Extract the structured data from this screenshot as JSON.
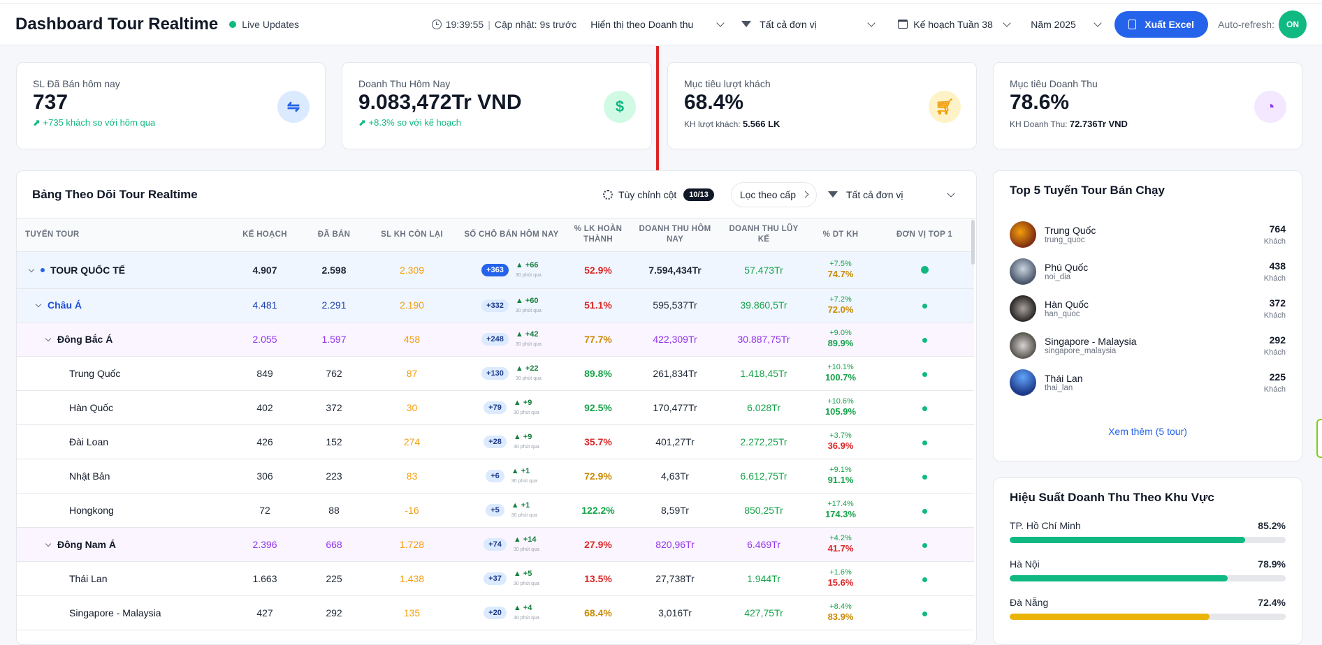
{
  "header": {
    "title": "Dashboard Tour Realtime",
    "live_label": "Live Updates",
    "time": "19:39:55",
    "updated": "Cập nhật: 9s trước",
    "display_select": "Hiển thị theo Doanh thu",
    "unit_select": "Tất cả đơn vị",
    "plan_select": "Kế hoạch Tuần 38",
    "year_select": "Năm 2025",
    "export_label": "Xuất Excel",
    "autorefresh_label": "Auto-refresh:",
    "autorefresh_state": "ON"
  },
  "kpis": [
    {
      "label": "SL Đã Bán hôm nay",
      "value": "737",
      "sub": "+735 khách so với hôm qua",
      "icon": "sliders-icon"
    },
    {
      "label": "Doanh Thu Hôm Nay",
      "value": "9.083,472Tr VND",
      "sub": "+8.3% so với kế hoạch",
      "icon": "dollar-icon"
    },
    {
      "label": "Mục tiêu lượt khách",
      "value": "68.4%",
      "sub_label": "KH lượt khách:",
      "sub_value": "5.566 LK",
      "icon": "cart-icon"
    },
    {
      "label": "Mục tiêu Doanh Thu",
      "value": "78.6%",
      "sub_label": "KH Doanh Thu:",
      "sub_value": "72.736Tr VND",
      "icon": "pie-chart-icon"
    }
  ],
  "table": {
    "title": "Bảng Theo Dõi Tour Realtime",
    "columns_btn": "Tùy chỉnh cột",
    "columns_count": "10/13",
    "filter_level": "Lọc theo cấp",
    "unit_filter": "Tất cả đơn vị",
    "headers": [
      "TUYẾN TOUR",
      "KẾ HOẠCH",
      "ĐÃ BÁN",
      "SL KH CÒN LẠI",
      "SỐ CHỖ BÁN HÔM NAY",
      "% LK HOÀN THÀNH",
      "DOANH THU HÔM NAY",
      "DOANH THU LŨY KẾ",
      "% DT KH",
      "ĐƠN VỊ TOP 1"
    ],
    "rows": [
      {
        "level": 0,
        "name": "TOUR QUỐC TẾ",
        "plan": "4.907",
        "sold": "2.598",
        "remain": "2.309",
        "today": "+363",
        "delta": "▲ +66",
        "ago": "30 phút qua",
        "pct": "52.9%",
        "rev_today": "7.594,434Tr",
        "rev_cum": "57.473Tr",
        "pdt_delta": "+7.5%",
        "pdt": "74.7%"
      },
      {
        "level": 1,
        "name": "Châu Á",
        "plan": "4.481",
        "sold": "2.291",
        "remain": "2.190",
        "today": "+332",
        "delta": "▲ +60",
        "ago": "30 phút qua",
        "pct": "51.1%",
        "rev_today": "595,537Tr",
        "rev_cum": "39.860,5Tr",
        "pdt_delta": "+7.2%",
        "pdt": "72.0%"
      },
      {
        "level": 2,
        "name": "Đông Bắc Á",
        "plan": "2.055",
        "sold": "1.597",
        "remain": "458",
        "today": "+248",
        "delta": "▲ +42",
        "ago": "30 phút qua",
        "pct": "77.7%",
        "rev_today": "422,309Tr",
        "rev_cum": "30.887,75Tr",
        "pdt_delta": "+9.0%",
        "pdt": "89.9%"
      },
      {
        "level": 3,
        "name": "Trung Quốc",
        "plan": "849",
        "sold": "762",
        "remain": "87",
        "today": "+130",
        "delta": "▲ +22",
        "ago": "30 phút qua",
        "pct": "89.8%",
        "rev_today": "261,834Tr",
        "rev_cum": "1.418,45Tr",
        "pdt_delta": "+10.1%",
        "pdt": "100.7%"
      },
      {
        "level": 3,
        "name": "Hàn Quốc",
        "plan": "402",
        "sold": "372",
        "remain": "30",
        "today": "+79",
        "delta": "▲ +9",
        "ago": "30 phút qua",
        "pct": "92.5%",
        "rev_today": "170,477Tr",
        "rev_cum": "6.028Tr",
        "pdt_delta": "+10.6%",
        "pdt": "105.9%"
      },
      {
        "level": 3,
        "name": "Đài Loan",
        "plan": "426",
        "sold": "152",
        "remain": "274",
        "today": "+28",
        "delta": "▲ +9",
        "ago": "30 phút qua",
        "pct": "35.7%",
        "rev_today": "401,27Tr",
        "rev_cum": "2.272,25Tr",
        "pdt_delta": "+3.7%",
        "pdt": "36.9%"
      },
      {
        "level": 3,
        "name": "Nhật Bản",
        "plan": "306",
        "sold": "223",
        "remain": "83",
        "today": "+6",
        "delta": "▲ +1",
        "ago": "30 phút qua",
        "pct": "72.9%",
        "rev_today": "4,63Tr",
        "rev_cum": "6.612,75Tr",
        "pdt_delta": "+9.1%",
        "pdt": "91.1%"
      },
      {
        "level": 3,
        "name": "Hongkong",
        "plan": "72",
        "sold": "88",
        "remain": "-16",
        "today": "+5",
        "delta": "▲ +1",
        "ago": "30 phút qua",
        "pct": "122.2%",
        "rev_today": "8,59Tr",
        "rev_cum": "850,25Tr",
        "pdt_delta": "+17.4%",
        "pdt": "174.3%"
      },
      {
        "level": 2,
        "name": "Đông Nam Á",
        "plan": "2.396",
        "sold": "668",
        "remain": "1.728",
        "today": "+74",
        "delta": "▲ +14",
        "ago": "30 phút qua",
        "pct": "27.9%",
        "rev_today": "820,96Tr",
        "rev_cum": "6.469Tr",
        "pdt_delta": "+4.2%",
        "pdt": "41.7%"
      },
      {
        "level": 3,
        "name": "Thái Lan",
        "plan": "1.663",
        "sold": "225",
        "remain": "1.438",
        "today": "+37",
        "delta": "▲ +5",
        "ago": "30 phút qua",
        "pct": "13.5%",
        "rev_today": "27,738Tr",
        "rev_cum": "1.944Tr",
        "pdt_delta": "+1.6%",
        "pdt": "15.6%"
      },
      {
        "level": 3,
        "name": "Singapore - Malaysia",
        "plan": "427",
        "sold": "292",
        "remain": "135",
        "today": "+20",
        "delta": "▲ +4",
        "ago": "30 phút qua",
        "pct": "68.4%",
        "rev_today": "3,016Tr",
        "rev_cum": "427,75Tr",
        "pdt_delta": "+8.4%",
        "pdt": "83.9%"
      }
    ]
  },
  "top5": {
    "title": "Top 5 Tuyến Tour Bán Chạy",
    "unit": "Khách",
    "more": "Xem thêm (5 tour)",
    "items": [
      {
        "name": "Trung Quốc",
        "code": "trung_quoc",
        "value": "764"
      },
      {
        "name": "Phú Quốc",
        "code": "noi_dia",
        "value": "438"
      },
      {
        "name": "Hàn Quốc",
        "code": "han_quoc",
        "value": "372"
      },
      {
        "name": "Singapore - Malaysia",
        "code": "singapore_malaysia",
        "value": "292"
      },
      {
        "name": "Thái Lan",
        "code": "thai_lan",
        "value": "225"
      }
    ]
  },
  "region": {
    "title": "Hiệu Suất Doanh Thu Theo Khu Vực",
    "items": [
      {
        "name": "TP. Hồ Chí Minh",
        "value": "85.2%",
        "pct": 0.852,
        "color": "#22c55e"
      },
      {
        "name": "Hà Nội",
        "value": "78.9%",
        "pct": 0.789,
        "color": "#22c55e"
      },
      {
        "name": "Đà Nẵng",
        "value": "72.4%",
        "pct": 0.724,
        "color": "#eab308"
      }
    ]
  },
  "colors": {
    "accent": "#2563eb",
    "green": "#10b981",
    "red": "#dc2626",
    "orange": "#f59e0b",
    "purple": "#9333ea"
  }
}
